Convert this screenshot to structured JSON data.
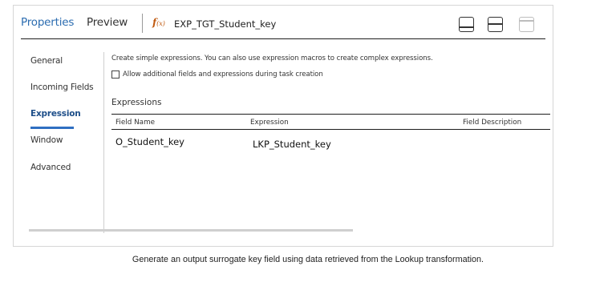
{
  "header": {
    "tabs": [
      {
        "label": "Properties",
        "active": true
      },
      {
        "label": "Preview",
        "active": false
      }
    ],
    "fx_icon": {
      "icon": "function-icon",
      "glyph": "f",
      "sub": "(x)"
    },
    "transformation_name": "EXP_TGT_Student_key",
    "layout_buttons": [
      {
        "icon": "panel-bottom-icon",
        "enabled": true
      },
      {
        "icon": "panel-split-icon",
        "enabled": true
      },
      {
        "icon": "panel-top-icon",
        "enabled": false
      }
    ]
  },
  "sidebar": {
    "items": [
      {
        "label": "General",
        "active": false
      },
      {
        "label": "Incoming Fields",
        "active": false
      },
      {
        "label": "Expression",
        "active": true
      },
      {
        "label": "Window",
        "active": false
      },
      {
        "label": "Advanced",
        "active": false
      }
    ]
  },
  "content": {
    "description": "Create simple expressions. You can also use expression macros to create complex expressions.",
    "allow_checkbox": {
      "label": "Allow additional fields and expressions during task creation",
      "checked": false
    },
    "section_title": "Expressions",
    "table": {
      "columns": [
        "Field Name",
        "Expression",
        "Field Description"
      ],
      "rows": [
        [
          "O_Student_key",
          "LKP_Student_key",
          ""
        ]
      ]
    }
  },
  "caption": "Generate an output surrogate key field using data retrieved from the Lookup transformation.",
  "colors": {
    "accent": "#2f6fc2",
    "function_icon": "#c05a10",
    "rule": "#1e1e1e"
  }
}
